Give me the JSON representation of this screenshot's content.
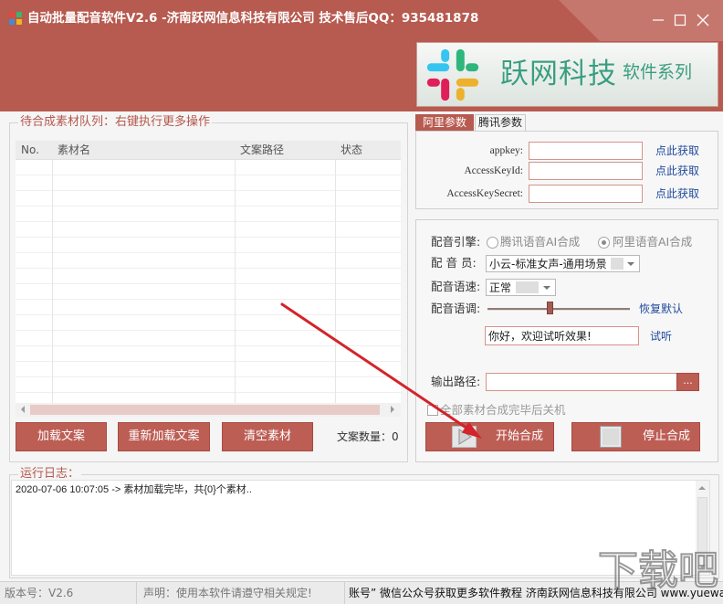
{
  "window": {
    "title": "自动批量配音软件V2.6 -济南跃网信息科技有限公司 技术售后QQ：935481878"
  },
  "banner": {
    "brand": "跃网科技",
    "series": "软件系列"
  },
  "queue": {
    "title": "待合成素材队列：右键执行更多操作",
    "columns": [
      "No.",
      "素材名",
      "文案路径",
      "状态"
    ],
    "rows": [],
    "load_button": "加载文案",
    "reload_button": "重新加载文案",
    "clear_button": "清空素材",
    "count_label": "文案数量：",
    "count": "0"
  },
  "params": {
    "tabs": [
      "阿里参数",
      "腾讯参数"
    ],
    "active_tab": 0,
    "fields": [
      {
        "label": "appkey:",
        "value": "",
        "link": "点此获取"
      },
      {
        "label": "AccessKeyId:",
        "value": "",
        "link": "点此获取"
      },
      {
        "label": "AccessKeySecret:",
        "value": "",
        "link": "点此获取"
      }
    ]
  },
  "voice": {
    "engine_label": "配音引擎:",
    "engine_options": [
      "腾讯语音AI合成",
      "阿里语音AI合成"
    ],
    "engine_selected": 1,
    "speaker_label": "配 音 员:",
    "speaker_value": "小云-标准女声-通用场景",
    "speed_label": "配音语速:",
    "speed_value": "正常",
    "pitch_label": "配音语调:",
    "pitch_level": 0.44,
    "reset_link": "恢复默认",
    "preview_text": "你好，欢迎试听效果!",
    "preview_link": "试听",
    "output_label": "输出路径:",
    "output_value": "",
    "browse_button": "...",
    "shutdown_label": "全部素材合成完毕后关机",
    "shutdown_checked": false,
    "start_button": "开始合成",
    "stop_button": "停止合成"
  },
  "log": {
    "title": "运行日志：",
    "lines": [
      "2020-07-06 10:07:05 -> 素材加载完毕，共{0}个素材.."
    ]
  },
  "status_bar": {
    "version": "版本号：V2.6",
    "notice": "声明：使用本软件请遵守相关规定!",
    "ticker": "账号” 微信公众号获取更多软件教程 济南跃网信息科技有限公司 www.yuewan"
  },
  "watermark": "下载吧",
  "icons": {
    "app": "app-icon",
    "minimize": "minimize-icon",
    "maximize": "maximize-icon",
    "close": "close-icon",
    "logo": "brand-logo-icon",
    "start": "play-icon",
    "stop": "stop-icon",
    "dropdown": "chevron-down-icon"
  },
  "colors": {
    "accent": "#b75a4f",
    "link": "#1f4a9c",
    "annotation": "#d4232a",
    "brand_text": "#3a9d80"
  }
}
